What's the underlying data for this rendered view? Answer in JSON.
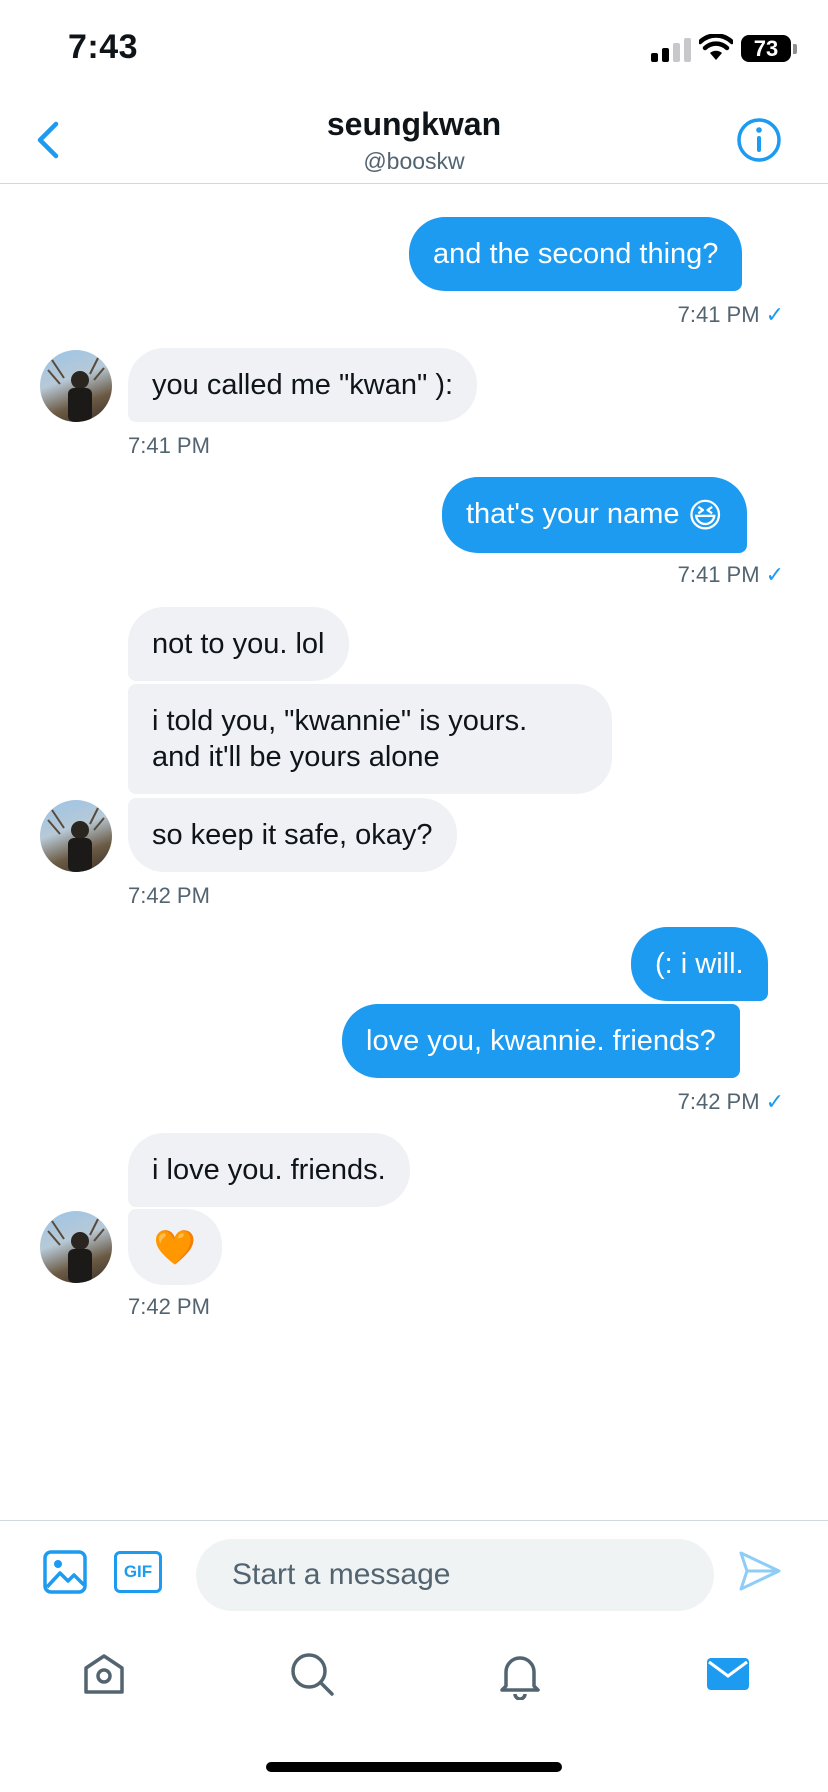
{
  "status_bar": {
    "time": "7:43",
    "battery": "73"
  },
  "header": {
    "title": "seungkwan",
    "handle": "@booskw",
    "back_icon": "chevron-left-icon",
    "info_icon": "info-circle-icon"
  },
  "messages": [
    {
      "direction": "out",
      "text": "and the second thing?"
    },
    {
      "direction": "out",
      "meta": "7:41 PM",
      "read": true
    },
    {
      "direction": "in",
      "text": "you called me \"kwan\" ):"
    },
    {
      "direction": "in",
      "meta": "7:41 PM"
    },
    {
      "direction": "out",
      "text": "that's your name",
      "emoji": "😆"
    },
    {
      "direction": "out",
      "meta": "7:41 PM",
      "read": true
    },
    {
      "direction": "in",
      "text": "not to you. lol"
    },
    {
      "direction": "in",
      "text_line1": "i told you, \"kwannie\" is yours.",
      "text_line2": "and it'll be yours alone"
    },
    {
      "direction": "in",
      "text": "so keep it safe, okay?"
    },
    {
      "direction": "in",
      "meta": "7:42 PM"
    },
    {
      "direction": "out",
      "text": "(: i will."
    },
    {
      "direction": "out",
      "text": "love you, kwannie. friends?"
    },
    {
      "direction": "out",
      "meta": "7:42 PM",
      "read": true
    },
    {
      "direction": "in",
      "text": "i love you. friends."
    },
    {
      "direction": "in",
      "emoji": "🧡"
    },
    {
      "direction": "in",
      "meta": "7:42 PM"
    }
  ],
  "read_mark": "✓",
  "compose": {
    "placeholder": "Start a message",
    "gif_label": "GIF"
  },
  "colors": {
    "accent": "#1d9bf0",
    "incoming_bubble": "#eff1f5",
    "secondary_text": "#536471"
  },
  "tabs": [
    "home-icon",
    "search-icon",
    "bell-icon",
    "mail-icon"
  ]
}
